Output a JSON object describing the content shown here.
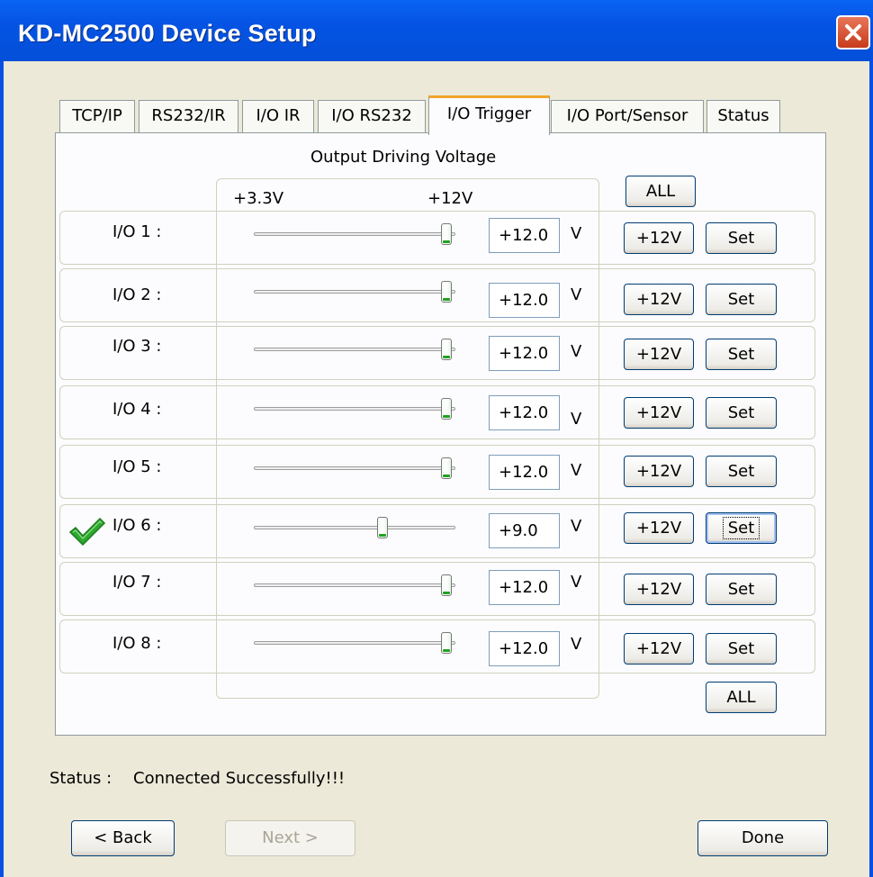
{
  "window": {
    "title": "KD-MC2500 Device Setup"
  },
  "tabs": [
    {
      "label": "TCP/IP"
    },
    {
      "label": "RS232/IR"
    },
    {
      "label": "I/O IR"
    },
    {
      "label": "I/O RS232"
    },
    {
      "label": "I/O Trigger",
      "active": true
    },
    {
      "label": "I/O Port/Sensor"
    },
    {
      "label": "Status"
    }
  ],
  "panel": {
    "heading": "Output Driving Voltage",
    "scale_min_label": "+3.3V",
    "scale_max_label": "+12V",
    "all_top_label": "ALL",
    "all_bottom_label": "ALL",
    "unit": "V",
    "rows": [
      {
        "label": "I/O 1 :",
        "value": "+12.0",
        "slider_fraction": 1.0,
        "btn12": "+12V",
        "set": "Set"
      },
      {
        "label": "I/O 2 :",
        "value": "+12.0",
        "slider_fraction": 1.0,
        "btn12": "+12V",
        "set": "Set"
      },
      {
        "label": "I/O 3 :",
        "value": "+12.0",
        "slider_fraction": 1.0,
        "btn12": "+12V",
        "set": "Set"
      },
      {
        "label": "I/O 4 :",
        "value": "+12.0",
        "slider_fraction": 1.0,
        "btn12": "+12V",
        "set": "Set"
      },
      {
        "label": "I/O 5 :",
        "value": "+12.0",
        "slider_fraction": 1.0,
        "btn12": "+12V",
        "set": "Set"
      },
      {
        "label": "I/O 6 :",
        "value": "+9.0",
        "slider_fraction": 0.655,
        "btn12": "+12V",
        "set": "Set",
        "checked": true,
        "focused": true
      },
      {
        "label": "I/O 7 :",
        "value": "+12.0",
        "slider_fraction": 1.0,
        "btn12": "+12V",
        "set": "Set"
      },
      {
        "label": "I/O 8 :",
        "value": "+12.0",
        "slider_fraction": 1.0,
        "btn12": "+12V",
        "set": "Set"
      }
    ]
  },
  "status": {
    "label": "Status :",
    "text": "Connected Successfully!!!"
  },
  "footer": {
    "back": "< Back",
    "next": "Next >",
    "done": "Done"
  },
  "colors": {
    "titlebar": "#0553e3",
    "close": "#d64a2b",
    "tab_active_accent": "#f1a42c",
    "check": "#2ea82e",
    "slider_thumb_accent": "#21a121"
  }
}
